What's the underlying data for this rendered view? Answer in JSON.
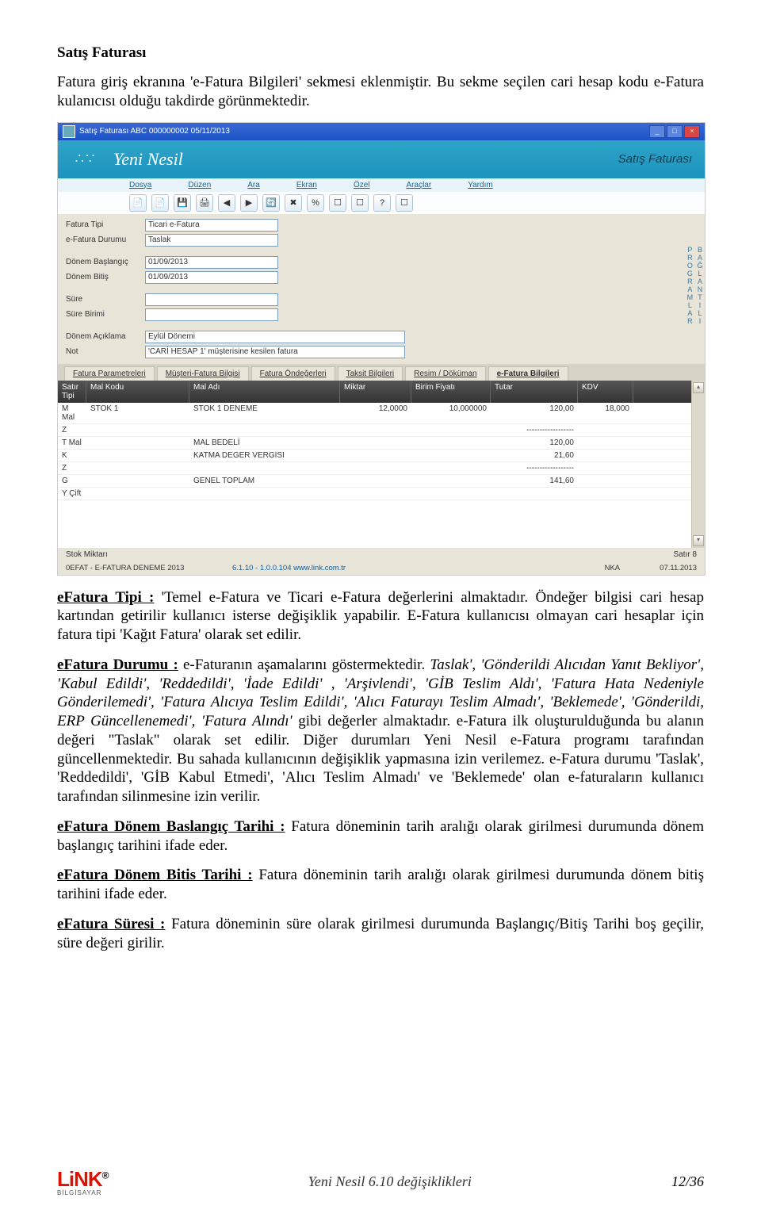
{
  "doc": {
    "h1": "Satış Faturası",
    "intro": "Fatura giriş ekranına 'e-Fatura Bilgileri' sekmesi eklenmiştir. Bu sekme seçilen cari hesap kodu e-Fatura kulanıcısı olduğu takdirde görünmektedir.",
    "tipi_label": "eFatura Tipi :",
    "tipi_body": " 'Temel e-Fatura ve Ticari e-Fatura değerlerini almaktadır. Öndeğer bilgisi cari hesap kartından getirilir kullanıcı isterse değişiklik yapabilir. E-Fatura kullanıcısı olmayan cari hesaplar için fatura tipi  'Kağıt Fatura' olarak set edilir.",
    "durumu_label": "eFatura Durumu :",
    "durumu_body1": " e-Faturanın aşamalarını göstermektedir. ",
    "durumu_italic": "Taslak', 'Gönderildi Alıcıdan Yanıt Bekliyor', 'Kabul Edildi', 'Reddedildi', 'İade Edildi' , 'Arşivlendi', 'GİB Teslim Aldı', 'Fatura Hata Nedeniyle Gönderilemedi', 'Fatura Alıcıya Teslim Edildi', 'Alıcı Faturayı Teslim Almadı', 'Beklemede', 'Gönderildi, ERP Güncellenemedi', 'Fatura Alındı'",
    "durumu_body2": " gibi değerler almaktadır. e-Fatura ilk oluşturulduğunda bu alanın değeri \"Taslak\" olarak set edilir. Diğer durumları Yeni Nesil e-Fatura programı tarafından güncellenmektedir. Bu sahada kullanıcının değişiklik yapmasına izin verilemez. e-Fatura durumu 'Taslak', 'Reddedildi', 'GİB Kabul Etmedi', 'Alıcı Teslim Almadı' ve  'Beklemede' olan e-faturaların kullanıcı tarafından silinmesine izin verilir.",
    "donem_bas_label": "eFatura Dönem Baslangıç Tarihi :",
    "donem_bas_body": " Fatura döneminin tarih aralığı olarak girilmesi durumunda dönem başlangıç tarihini ifade eder.",
    "donem_bit_label": "eFatura Dönem Bitis Tarihi :",
    "donem_bit_body": " Fatura döneminin tarih aralığı olarak girilmesi durumunda dönem bitiş tarihini ifade eder.",
    "sure_label": "eFatura Süresi :",
    "sure_body": " Fatura döneminin süre olarak girilmesi durumunda Başlangıç/Bitiş Tarihi boş geçilir, süre değeri girilir."
  },
  "scr": {
    "title": "Satış Faturası  ABC 000000002 05/11/2013",
    "brand": "Yeni Nesil",
    "pageTitle": "Satış Faturası",
    "menus": {
      "dosya": "Dosya",
      "duzen": "Düzen",
      "ara": "Ara",
      "ekran": "Ekran",
      "ozel": "Özel",
      "araclar": "Araçlar",
      "yardim": "Yardım"
    },
    "toolbar_icons": [
      "📄",
      "📄",
      "💾",
      "🖨",
      "◀",
      "▶",
      "🔄",
      "✖",
      "%",
      "☐",
      "☐",
      "?",
      "☐"
    ],
    "form": {
      "rows": [
        {
          "label": "Fatura Tipi",
          "value": "Ticari e-Fatura"
        },
        {
          "label": "e-Fatura Durumu",
          "value": "Taslak"
        },
        {
          "label": "",
          "value": ""
        },
        {
          "label": "Dönem Başlangıç",
          "value": "01/09/2013"
        },
        {
          "label": "Dönem Bitiş",
          "value": "01/09/2013"
        },
        {
          "label": "",
          "value": ""
        },
        {
          "label": "Süre",
          "value": ""
        },
        {
          "label": "Süre Birimi",
          "value": ""
        },
        {
          "label": "",
          "value": ""
        },
        {
          "label": "Dönem Açıklama",
          "value": "Eylül Dönemi"
        },
        {
          "label": "Not",
          "value": "'CARİ HESAP 1' müşterisine kesilen fatura"
        }
      ]
    },
    "side": {
      "top": "BAĞLANTILI",
      "bottom": "PROGRAMLAR"
    },
    "tabs": {
      "t1": "Fatura Parametreleri",
      "t2": "Müşteri-Fatura Bilgisi",
      "t3": "Fatura Öndeğerleri",
      "t4": "Taksit Bilgileri",
      "t5": "Resim / Döküman",
      "t6": "e-Fatura Bilgileri"
    },
    "grid_head": {
      "c1": "Satır\nTipi",
      "c2": "Mal Kodu",
      "c3": "Mal Adı",
      "c4": "Miktar",
      "c5": "Birim Fiyatı",
      "c6": "Tutar",
      "c7": "KDV"
    },
    "grid": [
      {
        "c1": "M  Mal",
        "c2": "STOK 1",
        "c3": "STOK 1 DENEME",
        "c4": "12,0000",
        "c5": "10,000000",
        "c6": "120,00",
        "c7": "18,000"
      },
      {
        "c1": "Z",
        "c2": "",
        "c3": "",
        "c4": "",
        "c5": "",
        "c6": "------------------",
        "c7": ""
      },
      {
        "c1": "T  Mal",
        "c2": "",
        "c3": "MAL BEDELİ",
        "c4": "",
        "c5": "",
        "c6": "120,00",
        "c7": ""
      },
      {
        "c1": "K",
        "c2": "",
        "c3": "KATMA DEGER VERGISI",
        "c4": "",
        "c5": "",
        "c6": "21,60",
        "c7": ""
      },
      {
        "c1": "Z",
        "c2": "",
        "c3": "",
        "c4": "",
        "c5": "",
        "c6": "------------------",
        "c7": ""
      },
      {
        "c1": "G",
        "c2": "",
        "c3": "GENEL TOPLAM",
        "c4": "",
        "c5": "",
        "c6": "141,60",
        "c7": ""
      },
      {
        "c1": "Y  Çift",
        "c2": "",
        "c3": "",
        "c4": "",
        "c5": "",
        "c6": "",
        "c7": ""
      }
    ],
    "status": {
      "s1": "Stok Miktarı",
      "s2": "Satır   8"
    },
    "footer": {
      "left": "0EFAT - E-FATURA DENEME 2013",
      "mid": "6.1.10 - 1.0.0.104   www.link.com.tr",
      "r1": "NKA",
      "r2": "07.11.2013"
    }
  },
  "page_footer": {
    "logo": "LiNK",
    "logo_sub": "BİLGİSAYAR",
    "center": "Yeni Nesil 6.10 değişiklikleri",
    "right": "12/36"
  }
}
